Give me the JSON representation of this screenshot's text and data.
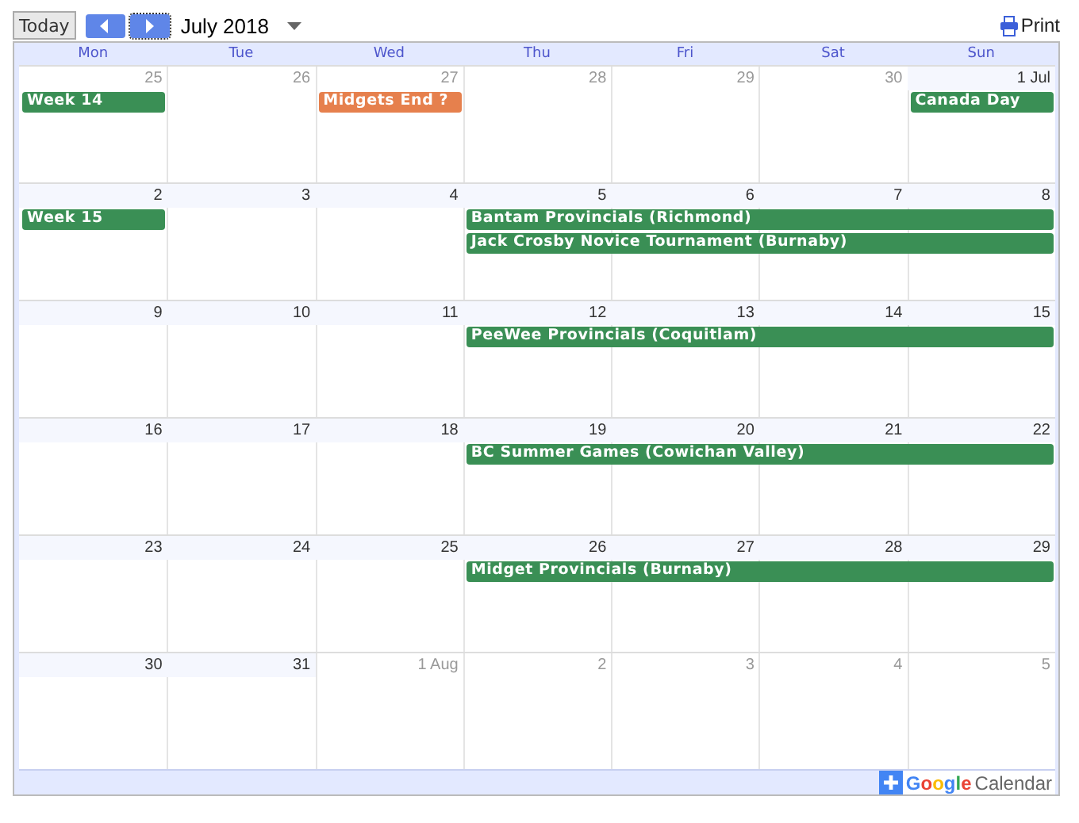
{
  "toolbar": {
    "today": "Today",
    "title": "July 2018",
    "print": "Print"
  },
  "weekdays": [
    "Mon",
    "Tue",
    "Wed",
    "Thu",
    "Fri",
    "Sat",
    "Sun"
  ],
  "weeks": [
    {
      "days": [
        {
          "label": "25",
          "in_month": false,
          "events": [
            {
              "title": "Week 14",
              "color": "#3a8f55",
              "through_week_end": false
            }
          ]
        },
        {
          "label": "26",
          "in_month": false
        },
        {
          "label": "27",
          "in_month": false,
          "events": [
            {
              "title": "Midgets End ?",
              "color": "#e6804d",
              "through_week_end": false
            }
          ]
        },
        {
          "label": "28",
          "in_month": false
        },
        {
          "label": "29",
          "in_month": false
        },
        {
          "label": "30",
          "in_month": false
        },
        {
          "label": "1 Jul",
          "in_month": true,
          "events": [
            {
              "title": "Canada Day",
              "color": "#3a8f55",
              "through_week_end": false
            }
          ]
        }
      ]
    },
    {
      "days": [
        {
          "label": "2",
          "in_month": true,
          "events": [
            {
              "title": "Week 15",
              "color": "#3a8f55",
              "through_week_end": false
            }
          ]
        },
        {
          "label": "3",
          "in_month": true
        },
        {
          "label": "4",
          "in_month": true
        },
        {
          "label": "5",
          "in_month": true,
          "events": [
            {
              "title": "Bantam Provincials (Richmond)",
              "color": "#3a8f55",
              "through_week_end": true
            },
            {
              "title": "Jack Crosby Novice Tournament (Burnaby)",
              "color": "#3a8f55",
              "through_week_end": true
            }
          ]
        },
        {
          "label": "6",
          "in_month": true
        },
        {
          "label": "7",
          "in_month": true
        },
        {
          "label": "8",
          "in_month": true
        }
      ]
    },
    {
      "days": [
        {
          "label": "9",
          "in_month": true
        },
        {
          "label": "10",
          "in_month": true
        },
        {
          "label": "11",
          "in_month": true
        },
        {
          "label": "12",
          "in_month": true,
          "events": [
            {
              "title": "PeeWee Provincials (Coquitlam)",
              "color": "#3a8f55",
              "through_week_end": true
            }
          ]
        },
        {
          "label": "13",
          "in_month": true
        },
        {
          "label": "14",
          "in_month": true
        },
        {
          "label": "15",
          "in_month": true
        }
      ]
    },
    {
      "days": [
        {
          "label": "16",
          "in_month": true
        },
        {
          "label": "17",
          "in_month": true
        },
        {
          "label": "18",
          "in_month": true
        },
        {
          "label": "19",
          "in_month": true,
          "events": [
            {
              "title": "BC Summer Games (Cowichan Valley)",
              "color": "#3a8f55",
              "through_week_end": true
            }
          ]
        },
        {
          "label": "20",
          "in_month": true
        },
        {
          "label": "21",
          "in_month": true
        },
        {
          "label": "22",
          "in_month": true
        }
      ]
    },
    {
      "days": [
        {
          "label": "23",
          "in_month": true
        },
        {
          "label": "24",
          "in_month": true
        },
        {
          "label": "25",
          "in_month": true
        },
        {
          "label": "26",
          "in_month": true,
          "events": [
            {
              "title": "Midget Provincials (Burnaby)",
              "color": "#3a8f55",
              "through_week_end": true
            }
          ]
        },
        {
          "label": "27",
          "in_month": true
        },
        {
          "label": "28",
          "in_month": true
        },
        {
          "label": "29",
          "in_month": true
        }
      ]
    },
    {
      "days": [
        {
          "label": "30",
          "in_month": true
        },
        {
          "label": "31",
          "in_month": true
        },
        {
          "label": "1 Aug",
          "in_month": false
        },
        {
          "label": "2",
          "in_month": false
        },
        {
          "label": "3",
          "in_month": false
        },
        {
          "label": "4",
          "in_month": false
        },
        {
          "label": "5",
          "in_month": false
        }
      ]
    }
  ],
  "footer": {
    "brand": "Google",
    "product": "Calendar"
  }
}
